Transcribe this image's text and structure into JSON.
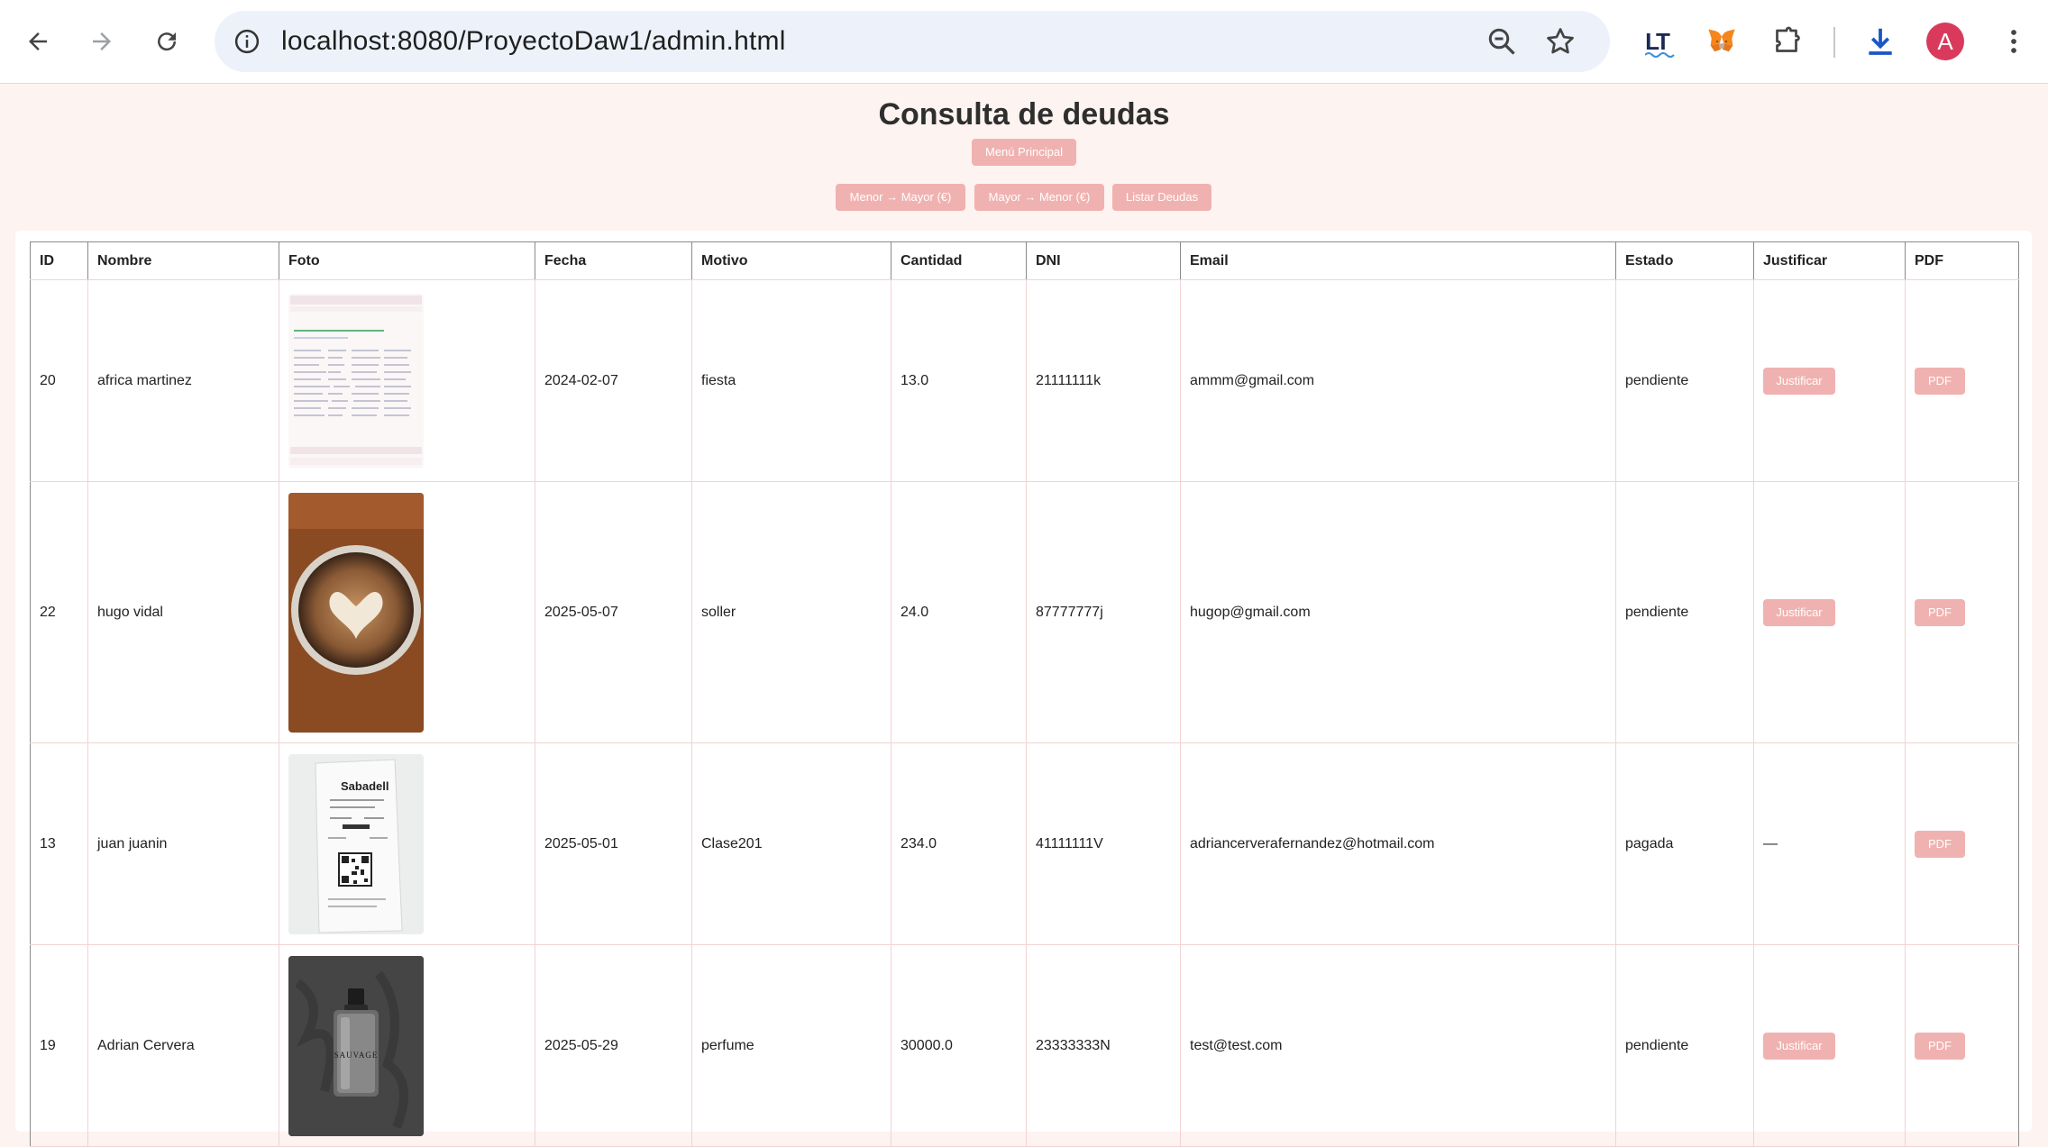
{
  "browser": {
    "url": "localhost:8080/ProyectoDaw1/admin.html",
    "avatar_letter": "A"
  },
  "page": {
    "title": "Consulta de deudas",
    "menu_button": "Menú Principal",
    "sort_asc_button": "Menor → Mayor (€)",
    "sort_desc_button": "Mayor → Menor (€)",
    "list_button": "Listar Deudas"
  },
  "table": {
    "headers": [
      "ID",
      "Nombre",
      "Foto",
      "Fecha",
      "Motivo",
      "Cantidad",
      "DNI",
      "Email",
      "Estado",
      "Justificar",
      "PDF"
    ],
    "justify_label": "Justificar",
    "pdf_label": "PDF",
    "rows": [
      {
        "id": "20",
        "nombre": "africa martinez",
        "foto": "screenshot",
        "fecha": "2024-02-07",
        "motivo": "fiesta",
        "cantidad": "13.0",
        "dni": "21111111k",
        "email": "ammm@gmail.com",
        "estado": "pendiente",
        "justificar": "Justificar"
      },
      {
        "id": "22",
        "nombre": "hugo vidal",
        "foto": "coffee",
        "fecha": "2025-05-07",
        "motivo": "soller",
        "cantidad": "24.0",
        "dni": "87777777j",
        "email": "hugop@gmail.com",
        "estado": "pendiente",
        "justificar": "Justificar"
      },
      {
        "id": "13",
        "nombre": "juan juanin",
        "foto": "receipt",
        "fecha": "2025-05-01",
        "motivo": "Clase201",
        "cantidad": "234.0",
        "dni": "41111111V",
        "email": "adriancerverafernandez@hotmail.com",
        "estado": "pagada",
        "justificar": "—"
      },
      {
        "id": "19",
        "nombre": "Adrian Cervera",
        "foto": "perfume",
        "fecha": "2025-05-29",
        "motivo": "perfume",
        "cantidad": "30000.0",
        "dni": "23333333N",
        "email": "test@test.com",
        "estado": "pendiente",
        "justificar": "Justificar"
      }
    ]
  },
  "colors": {
    "page_bg": "#fdf3f1",
    "button_bg": "#f0b2b0",
    "avatar_bg": "#d93a5c"
  }
}
